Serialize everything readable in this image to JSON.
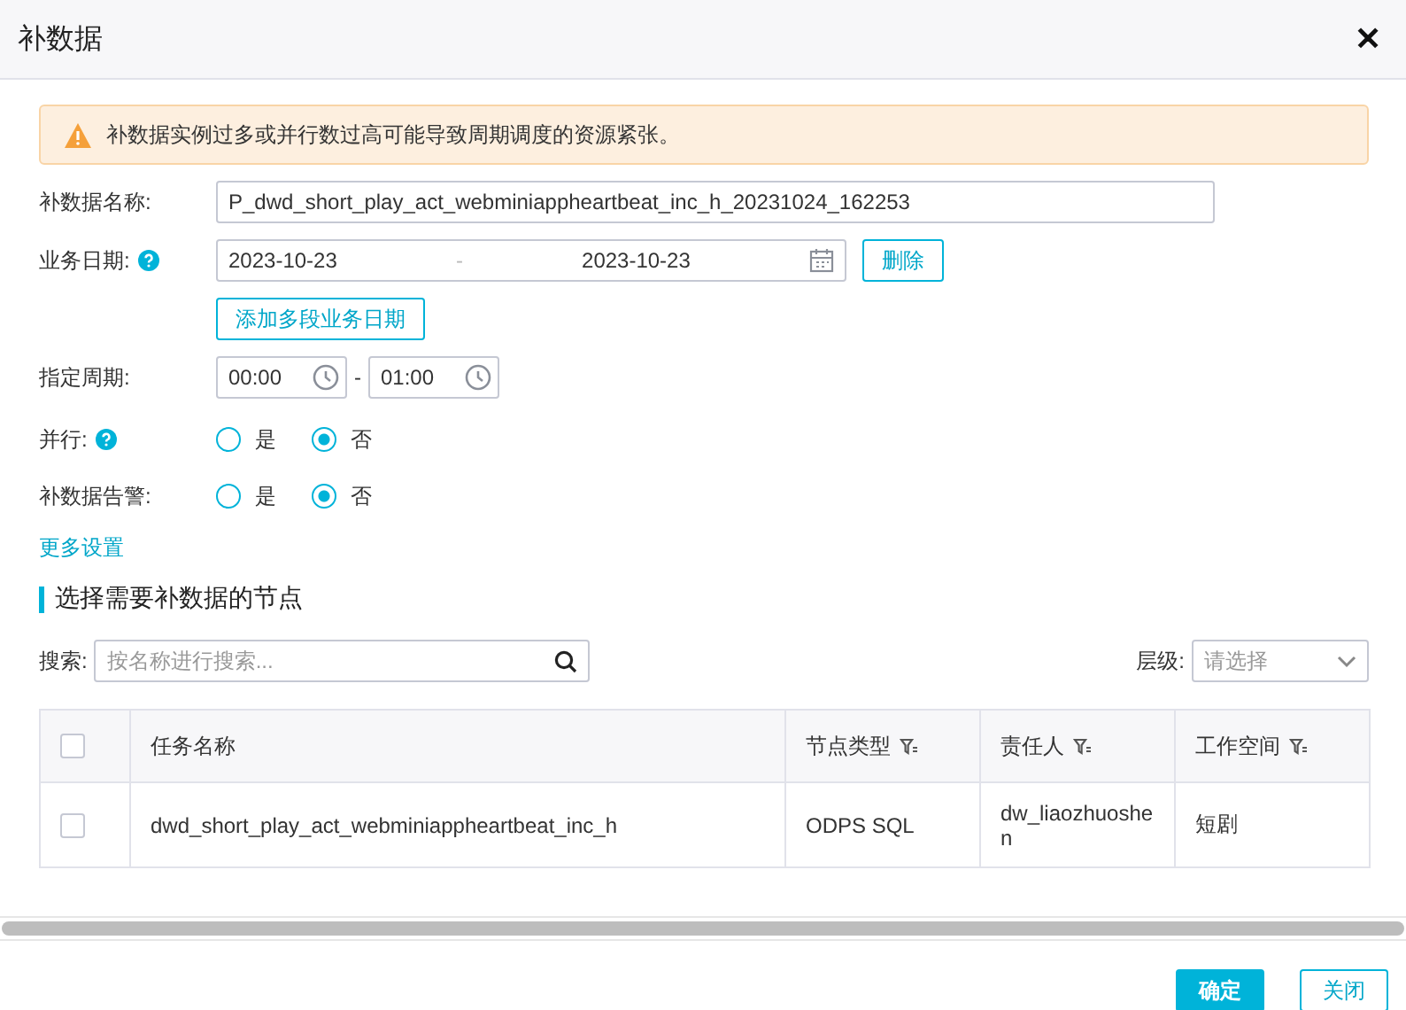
{
  "dialog": {
    "title": "补数据",
    "close": "✕"
  },
  "alert": {
    "text": "补数据实例过多或并行数过高可能导致周期调度的资源紧张。"
  },
  "form": {
    "name_label": "补数据名称:",
    "name_value": "P_dwd_short_play_act_webminiappheartbeat_inc_h_20231024_162253",
    "date_label": "业务日期:",
    "date_start": "2023-10-23",
    "date_separator": "-",
    "date_end": "2023-10-23",
    "delete_button": "删除",
    "add_dates_button": "添加多段业务日期",
    "period_label": "指定周期:",
    "period_start": "00:00",
    "period_separator": "-",
    "period_end": "01:00",
    "radio_groups": [
      {
        "label": "并行:",
        "help": true,
        "options": [
          {
            "label": "是",
            "selected": false
          },
          {
            "label": "否",
            "selected": true
          }
        ]
      },
      {
        "label": "补数据告警:",
        "help": false,
        "options": [
          {
            "label": "是",
            "selected": false
          },
          {
            "label": "否",
            "selected": true
          }
        ]
      }
    ],
    "more_settings": "更多设置"
  },
  "section": {
    "title": "选择需要补数据的节点",
    "search_label": "搜索:",
    "search_placeholder": "按名称进行搜索...",
    "level_label": "层级:",
    "level_placeholder": "请选择"
  },
  "table": {
    "columns": [
      {
        "label": "任务名称",
        "filter": false
      },
      {
        "label": "节点类型",
        "filter": true
      },
      {
        "label": "责任人",
        "filter": true
      },
      {
        "label": "工作空间",
        "filter": true
      }
    ],
    "header_checked": false,
    "rows": [
      {
        "checked": false,
        "cells": [
          "dwd_short_play_act_webminiappheartbeat_inc_h",
          "ODPS SQL",
          "dw_liaozhuoshen",
          "短剧"
        ]
      }
    ]
  },
  "footer": {
    "buttons": [
      {
        "label": "确定",
        "kind": "primary"
      },
      {
        "label": "关闭",
        "kind": "secondary"
      }
    ]
  }
}
